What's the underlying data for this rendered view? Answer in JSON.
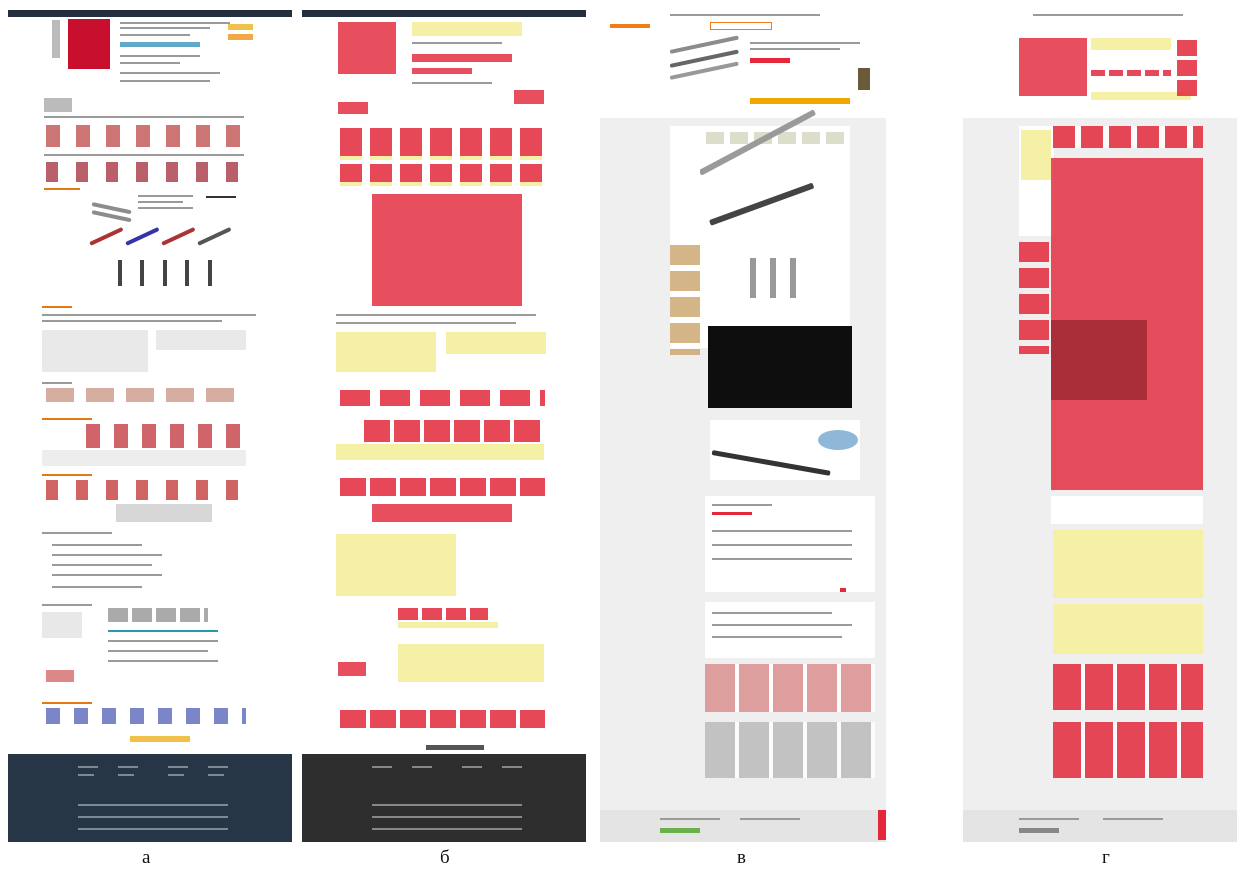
{
  "captions": {
    "a": "а",
    "b": "б",
    "c": "в",
    "d": "г"
  },
  "colors": {
    "highlight_red": "#e2283a",
    "highlight_yellow": "#f6f0a6",
    "footer_dark_blue": "#263646",
    "footer_dark_gray": "#2e2e2e",
    "panel_background_gray": "#efefef"
  }
}
